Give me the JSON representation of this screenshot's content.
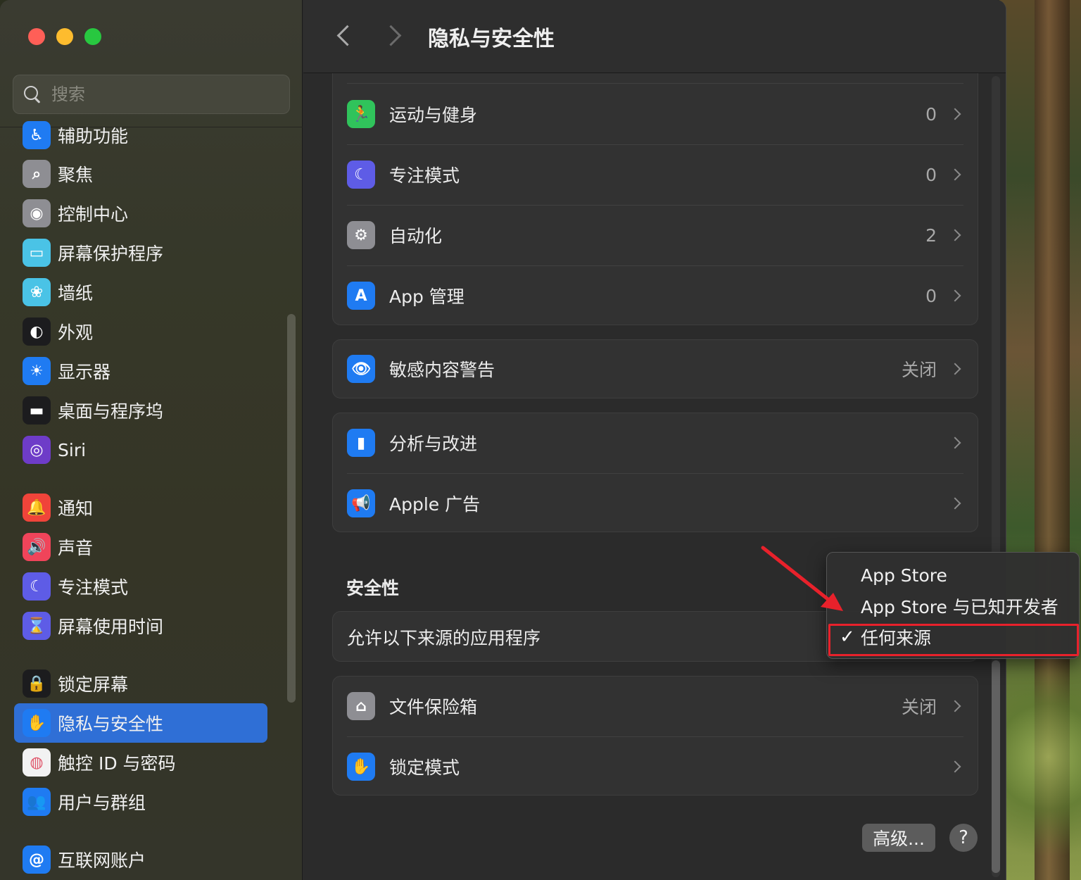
{
  "window": {
    "title": "隐私与安全性"
  },
  "search": {
    "placeholder": "搜索"
  },
  "colors": {
    "accent": "#2f6fd6",
    "annotation_red": "#e8212b"
  },
  "sidebar": {
    "items": [
      {
        "label": "辅助功能",
        "icon": "accessibility-icon",
        "color": "#1f7bf2",
        "glyph": "♿"
      },
      {
        "label": "聚焦",
        "icon": "spotlight-icon",
        "color": "#8e8e93",
        "glyph": "⌕"
      },
      {
        "label": "控制中心",
        "icon": "control-center-icon",
        "color": "#8e8e93",
        "glyph": "◉"
      },
      {
        "label": "屏幕保护程序",
        "icon": "screensaver-icon",
        "color": "#4ac3e6",
        "glyph": "▭"
      },
      {
        "label": "墙纸",
        "icon": "wallpaper-icon",
        "color": "#4ac3e6",
        "glyph": "❀"
      },
      {
        "label": "外观",
        "icon": "appearance-icon",
        "color": "#1c1c1e",
        "glyph": "◐"
      },
      {
        "label": "显示器",
        "icon": "displays-icon",
        "color": "#1f7bf2",
        "glyph": "☀"
      },
      {
        "label": "桌面与程序坞",
        "icon": "desktop-dock-icon",
        "color": "#1c1c1e",
        "glyph": "▬"
      },
      {
        "label": "Siri",
        "icon": "siri-icon",
        "color": "#6e3cc8",
        "glyph": "◎"
      },
      {
        "label": "通知",
        "icon": "notifications-icon",
        "color": "#f0443a",
        "glyph": "🔔"
      },
      {
        "label": "声音",
        "icon": "sound-icon",
        "color": "#f0445a",
        "glyph": "🔊"
      },
      {
        "label": "专注模式",
        "icon": "focus-icon",
        "color": "#5e5ce6",
        "glyph": "☾"
      },
      {
        "label": "屏幕使用时间",
        "icon": "screen-time-icon",
        "color": "#5e5ce6",
        "glyph": "⌛"
      },
      {
        "label": "锁定屏幕",
        "icon": "lock-screen-icon",
        "color": "#1c1c1e",
        "glyph": "🔒"
      },
      {
        "label": "隐私与安全性",
        "icon": "privacy-hand-icon",
        "color": "#1f7bf2",
        "glyph": "✋",
        "active": true
      },
      {
        "label": "触控 ID 与密码",
        "icon": "touch-id-icon",
        "color": "#f2f2f2",
        "glyph": "◍"
      },
      {
        "label": "用户与群组",
        "icon": "users-groups-icon",
        "color": "#1f7bf2",
        "glyph": "👥"
      },
      {
        "label": "互联网账户",
        "icon": "internet-accounts-icon",
        "color": "#1f7bf2",
        "glyph": "@"
      }
    ]
  },
  "main": {
    "privacy_rows": [
      {
        "label": "运动与健身",
        "value": "0",
        "icon": "fitness-icon",
        "color": "#30c35b",
        "glyph": "🏃"
      },
      {
        "label": "专注模式",
        "value": "0",
        "icon": "focus-moon-icon",
        "color": "#5e5ce6",
        "glyph": "☾"
      },
      {
        "label": "自动化",
        "value": "2",
        "icon": "automation-gears-icon",
        "color": "#8e8e93",
        "glyph": "⚙"
      },
      {
        "label": "App 管理",
        "value": "0",
        "icon": "app-store-icon",
        "color": "#1f7bf2",
        "glyph": "A"
      }
    ],
    "sensitive_row": {
      "label": "敏感内容警告",
      "value": "关闭",
      "icon": "eye-warning-icon",
      "color": "#1f7bf2",
      "glyph": "👁"
    },
    "analytics_rows": [
      {
        "label": "分析与改进",
        "icon": "analytics-chart-icon",
        "color": "#1f7bf2",
        "glyph": "▮"
      },
      {
        "label": "Apple 广告",
        "icon": "apple-ads-icon",
        "color": "#1f7bf2",
        "glyph": "📢"
      }
    ],
    "security_title": "安全性",
    "allow_apps_label": "允许以下来源的应用程序",
    "security_rows": [
      {
        "label": "文件保险箱",
        "value": "关闭",
        "icon": "filevault-icon",
        "color": "#8e8e93",
        "glyph": "⌂"
      },
      {
        "label": "锁定模式",
        "icon": "lockdown-hand-icon",
        "color": "#1f7bf2",
        "glyph": "✋"
      }
    ],
    "advanced_label": "高级...",
    "help_label": "?"
  },
  "popup": {
    "options": [
      {
        "label": "App Store",
        "checked": false
      },
      {
        "label": "App Store 与已知开发者",
        "checked": false
      },
      {
        "label": "任何来源",
        "checked": true
      }
    ],
    "check_glyph": "✓"
  }
}
